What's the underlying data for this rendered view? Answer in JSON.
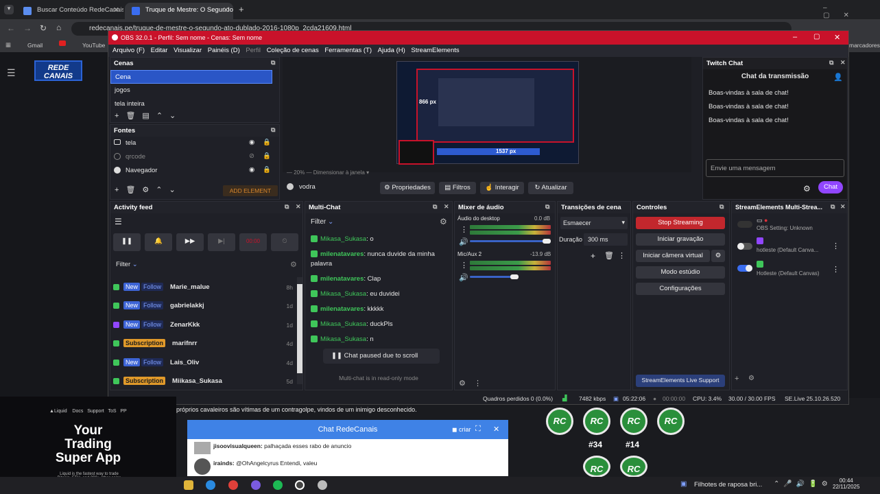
{
  "browser": {
    "tabs": [
      {
        "title": "Buscar Conteúdo RedeCanais: ",
        "active": false
      },
      {
        "title": "Truque de Mestre: O Segundo ",
        "active": true
      }
    ],
    "url": "redecanais.pe/truque-de-mestre-o-segundo-ato-dublado-2016-1080p_2cda21609.html",
    "bookmarks": [
      "Gmail",
      "YouTube"
    ],
    "bookmarks_right": "marcadores"
  },
  "site": {
    "logo": "REDE CANAIS",
    "caption": "próprios cavaleiros são vítimas de um contragolpe, vindos de um inimigo desconhecido."
  },
  "obs": {
    "title": "OBS 32.0.1 - Perfil: Sem nome - Cenas: Sem nome",
    "menu": [
      "Arquivo (F)",
      "Editar",
      "Visualizar",
      "Painéis (D)",
      "Perfil",
      "Coleção de cenas",
      "Ferramentas (T)",
      "Ajuda (H)",
      "StreamElements"
    ],
    "scenes": {
      "title": "Cenas",
      "items": [
        "Cena",
        "jogos",
        "tela inteira"
      ]
    },
    "sources": {
      "title": "Fontes",
      "items": [
        "tela",
        "qrcode",
        "Navegador"
      ],
      "add_label": "ADD ELEMENT"
    },
    "preview": {
      "zoom": "20%",
      "zoom_label": "Dimensionar à janela",
      "px_label_1": "866 px",
      "px_label_2": "1537 px",
      "source_name": "vodra"
    },
    "source_toolbar": [
      "Propriedades",
      "Filtros",
      "Interagir",
      "Atualizar"
    ],
    "twitch_chat": {
      "title": "Twitch Chat",
      "heading": "Chat da transmissão",
      "messages": [
        "Boas-vindas à sala de chat!",
        "Boas-vindas à sala de chat!",
        "Boas-vindas à sala de chat!"
      ],
      "input_placeholder": "Envie uma mensagem",
      "chat_button": "Chat"
    },
    "activity": {
      "title": "Activity feed",
      "filter": "Filter",
      "timer": "00:00",
      "items": [
        {
          "platform": "kick",
          "badges": [
            "New",
            "Follow"
          ],
          "name": "Marie_malue",
          "time": "8h"
        },
        {
          "platform": "kick",
          "badges": [
            "New",
            "Follow"
          ],
          "name": "gabrielakkj",
          "time": "1d"
        },
        {
          "platform": "twitch",
          "badges": [
            "New",
            "Follow"
          ],
          "name": "ZenarKkk",
          "time": "1d"
        },
        {
          "platform": "kick",
          "badges": [
            "Subscription"
          ],
          "name": "marifnrr",
          "time": "4d"
        },
        {
          "platform": "kick",
          "badges": [
            "New",
            "Follow"
          ],
          "name": "Lais_Oliv",
          "time": "4d"
        },
        {
          "platform": "kick",
          "badges": [
            "Subscription"
          ],
          "name": "Miikasa_Sukasa",
          "time": "5d"
        }
      ]
    },
    "multichat": {
      "title": "Multi-Chat",
      "filter": "Filter",
      "messages": [
        {
          "user": "Mikasa_Sukasa",
          "text": "o"
        },
        {
          "user": "milenatavares",
          "text": "nunca duvide da minha palavra"
        },
        {
          "user": "milenatavares",
          "text": "Clap"
        },
        {
          "user": "Mikasa_Sukasa",
          "text": "eu duvidei"
        },
        {
          "user": "milenatavares",
          "text": "kkkkk"
        },
        {
          "user": "Mikasa_Sukasa",
          "text": "duckPls"
        },
        {
          "user": "Mikasa_Sukasa",
          "text": "n"
        }
      ],
      "paused": "Chat paused due to scroll",
      "footer": "Multi-chat is in read-only mode"
    },
    "mixer": {
      "title": "Mixer de áudio",
      "channels": [
        {
          "name": "Áudio do desktop",
          "db": "0.0 dB",
          "level": 0.95
        },
        {
          "name": "Mic/Aux 2",
          "db": "-13.9 dB",
          "level": 0.55
        }
      ]
    },
    "transitions": {
      "title": "Transições de cena",
      "type": "Esmaecer",
      "duration_label": "Duração",
      "duration": "300 ms"
    },
    "controls": {
      "title": "Controles",
      "buttons": [
        "Stop Streaming",
        "Iniciar gravação",
        "Iniciar câmera virtual",
        "Modo estúdio",
        "Configurações"
      ],
      "support": "StreamElements Live Support"
    },
    "se_multistream": {
      "title": "StreamElements Multi-Strea...",
      "items": [
        {
          "label": "OBS Setting: Unknown",
          "on": false
        },
        {
          "label": "hotleste (Default Canva...",
          "on": false
        },
        {
          "label": "Hotleste (Default Canvas)",
          "on": true
        }
      ]
    },
    "status": {
      "frames": "Quadros perdidos 0 (0.0%)",
      "kbps": "7482 kbps",
      "live": "05:22:06",
      "rec": "00:00:00",
      "cpu": "CPU: 3.4%",
      "fps": "30.00 / 30.00 FPS",
      "version": "SE.Live 25.10.26.520"
    }
  },
  "ad": {
    "brand": "Liquid",
    "nav": [
      "Docs",
      "Support",
      "ToS",
      "PP"
    ],
    "headline_1": "Your",
    "headline_2": "Trading",
    "headline_3": "Super App",
    "body": "Liquid is the fastest way to trade Bitcoin, ETH, and 200+ other coins with up to 40x multipliers"
  },
  "chat_redecanais": {
    "title": "Chat RedeCanais",
    "mode": "criar",
    "messages": [
      {
        "user": "jisoovisualqueen:",
        "text": "palhaçada esses rabo de anuncio"
      },
      {
        "user": "irainds:",
        "text": "@OhAngelcyrus Entendi, valeu"
      }
    ]
  },
  "rc_icons": {
    "label": "RC",
    "numbers": [
      "#34",
      "#14"
    ]
  },
  "taskbar": {
    "now_playing": "Filhotes de raposa bri...",
    "time": "00:44",
    "date": "22/11/2025"
  }
}
